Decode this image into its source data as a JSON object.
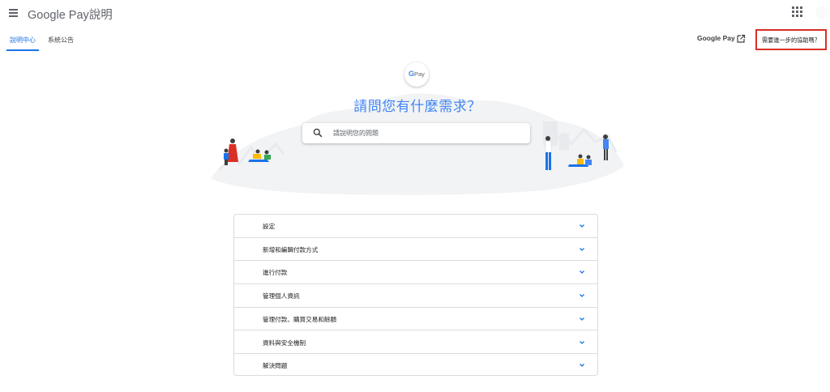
{
  "header": {
    "app_title": "Google Pay說明",
    "menu_icon": "menu-icon",
    "apps_icon": "apps-grid-icon",
    "tabs": [
      {
        "label": "說明中心",
        "active": true
      },
      {
        "label": "系統公告",
        "active": false
      }
    ],
    "google_pay_link": "Google Pay",
    "external_link_icon": "external-link-icon",
    "more_help_link": "需要進一步的協助嗎？"
  },
  "hero": {
    "badge_g": "G",
    "badge_pay": "Pay",
    "title": "請問您有什麼需求？",
    "search_placeholder": "請說明您的問題"
  },
  "topics": [
    {
      "label": "設定"
    },
    {
      "label": "新增和編輯付款方式"
    },
    {
      "label": "進行付款"
    },
    {
      "label": "管理個人資訊"
    },
    {
      "label": "管理付款、購買交易和餘額"
    },
    {
      "label": "資料與安全機制"
    },
    {
      "label": "解決問題"
    }
  ],
  "colors": {
    "accent": "#1a73e8",
    "hero_title": "#4285f4",
    "highlight_border": "#d93025"
  }
}
